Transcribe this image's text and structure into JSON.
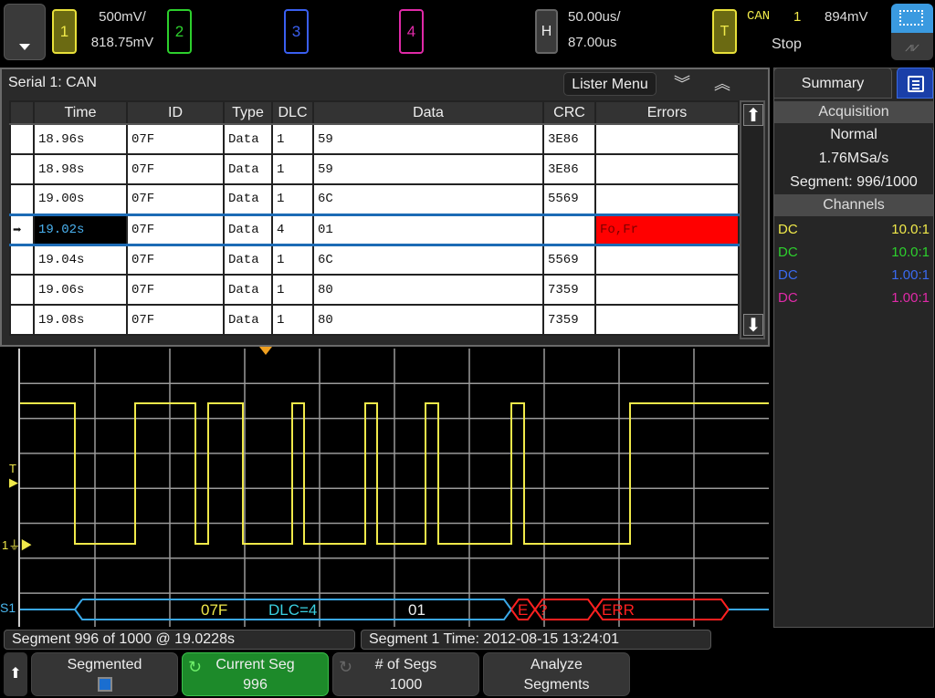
{
  "top_bar": {
    "channels": [
      {
        "label": "1",
        "scale": "500mV/",
        "offset": "818.75mV",
        "color": "#f0e94a"
      },
      {
        "label": "2",
        "color": "#2dd02d"
      },
      {
        "label": "3",
        "color": "#3a5ff0"
      },
      {
        "label": "4",
        "color": "#e02aa8"
      }
    ],
    "horizontal": {
      "label": "H",
      "timebase": "50.00us/",
      "delay": "87.00us"
    },
    "trigger": {
      "label": "T",
      "type": "CAN",
      "source": "1",
      "level": "894mV",
      "state": "Stop"
    }
  },
  "lister": {
    "title": "Serial 1: CAN",
    "menu_label": "Lister Menu",
    "columns": [
      "",
      "Time",
      "ID",
      "Type",
      "DLC",
      "Data",
      "CRC",
      "Errors"
    ],
    "rows": [
      {
        "time": "18.96s",
        "id": "07F",
        "type": "Data",
        "dlc": "1",
        "data": "59",
        "crc": "3E86",
        "errors": ""
      },
      {
        "time": "18.98s",
        "id": "07F",
        "type": "Data",
        "dlc": "1",
        "data": "59",
        "crc": "3E86",
        "errors": ""
      },
      {
        "time": "19.00s",
        "id": "07F",
        "type": "Data",
        "dlc": "1",
        "data": "6C",
        "crc": "5569",
        "errors": ""
      },
      {
        "time": "19.02s",
        "id": "07F",
        "type": "Data",
        "dlc": "4",
        "data": "01",
        "crc": "",
        "errors": "Fo,Fr",
        "selected": true
      },
      {
        "time": "19.04s",
        "id": "07F",
        "type": "Data",
        "dlc": "1",
        "data": "6C",
        "crc": "5569",
        "errors": ""
      },
      {
        "time": "19.06s",
        "id": "07F",
        "type": "Data",
        "dlc": "1",
        "data": "80",
        "crc": "7359",
        "errors": ""
      },
      {
        "time": "19.08s",
        "id": "07F",
        "type": "Data",
        "dlc": "1",
        "data": "80",
        "crc": "7359",
        "errors": ""
      }
    ]
  },
  "waveform": {
    "trigger_marker": "T",
    "channel_marker": "1",
    "bus_label": "S1",
    "decode": {
      "id": "07F",
      "dlc": "DLC=4",
      "data": "01",
      "err1": "E",
      "err2": "?",
      "err3": "ERR"
    }
  },
  "summary": {
    "tab_label": "Summary",
    "acquisition_header": "Acquisition",
    "mode": "Normal",
    "sample_rate": "1.76MSa/s",
    "segment": "Segment: 996/1000",
    "channels_header": "Channels",
    "channels": [
      {
        "coupling": "DC",
        "probe": "10.0:1",
        "color": "#f0e94a"
      },
      {
        "coupling": "DC",
        "probe": "10.0:1",
        "color": "#2dd02d"
      },
      {
        "coupling": "DC",
        "probe": "1.00:1",
        "color": "#3a6af0"
      },
      {
        "coupling": "DC",
        "probe": "1.00:1",
        "color": "#e02aa8"
      }
    ]
  },
  "status": {
    "left": "Segment 996 of 1000 @ 19.0228s",
    "right": "Segment 1 Time: 2012-08-15 13:24:01"
  },
  "softkeys": {
    "segmented": {
      "label": "Segmented",
      "checked": true
    },
    "current_seg": {
      "label": "Current Seg",
      "value": "996"
    },
    "num_segs": {
      "label": "# of Segs",
      "value": "1000"
    },
    "analyze": {
      "label": "Analyze",
      "label2": "Segments"
    }
  }
}
